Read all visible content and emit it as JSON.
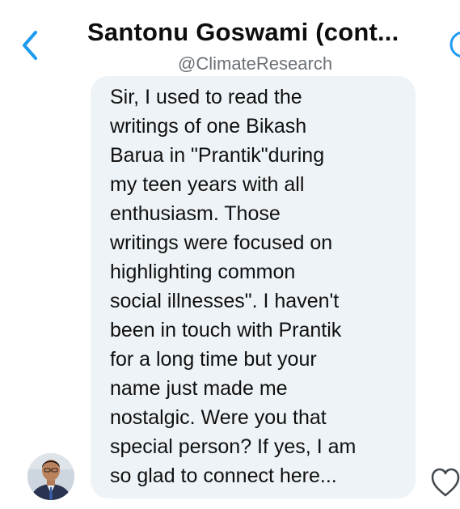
{
  "header": {
    "title": "Santonu Goswami (cont...",
    "handle": "@ClimateResearch"
  },
  "message": {
    "text": "Sir, I used to read the\nwritings of one Bikash\nBarua in \"Prantik\"during\nmy teen years with all\nenthusiasm. Those\nwritings were focused on\nhighlighting common\nsocial illnesses\". I haven't\nbeen in touch with Prantik\nfor a long time but your\nname just made me\nnostalgic. Were you that\nspecial person? If yes, I am\nso glad to connect here..."
  },
  "icons": {
    "back": "chevron-left-icon",
    "info": "info-icon",
    "like": "heart-icon"
  },
  "colors": {
    "accent": "#1d9bf0",
    "bubble": "#eef3f7",
    "handle_text": "#6b7177"
  }
}
